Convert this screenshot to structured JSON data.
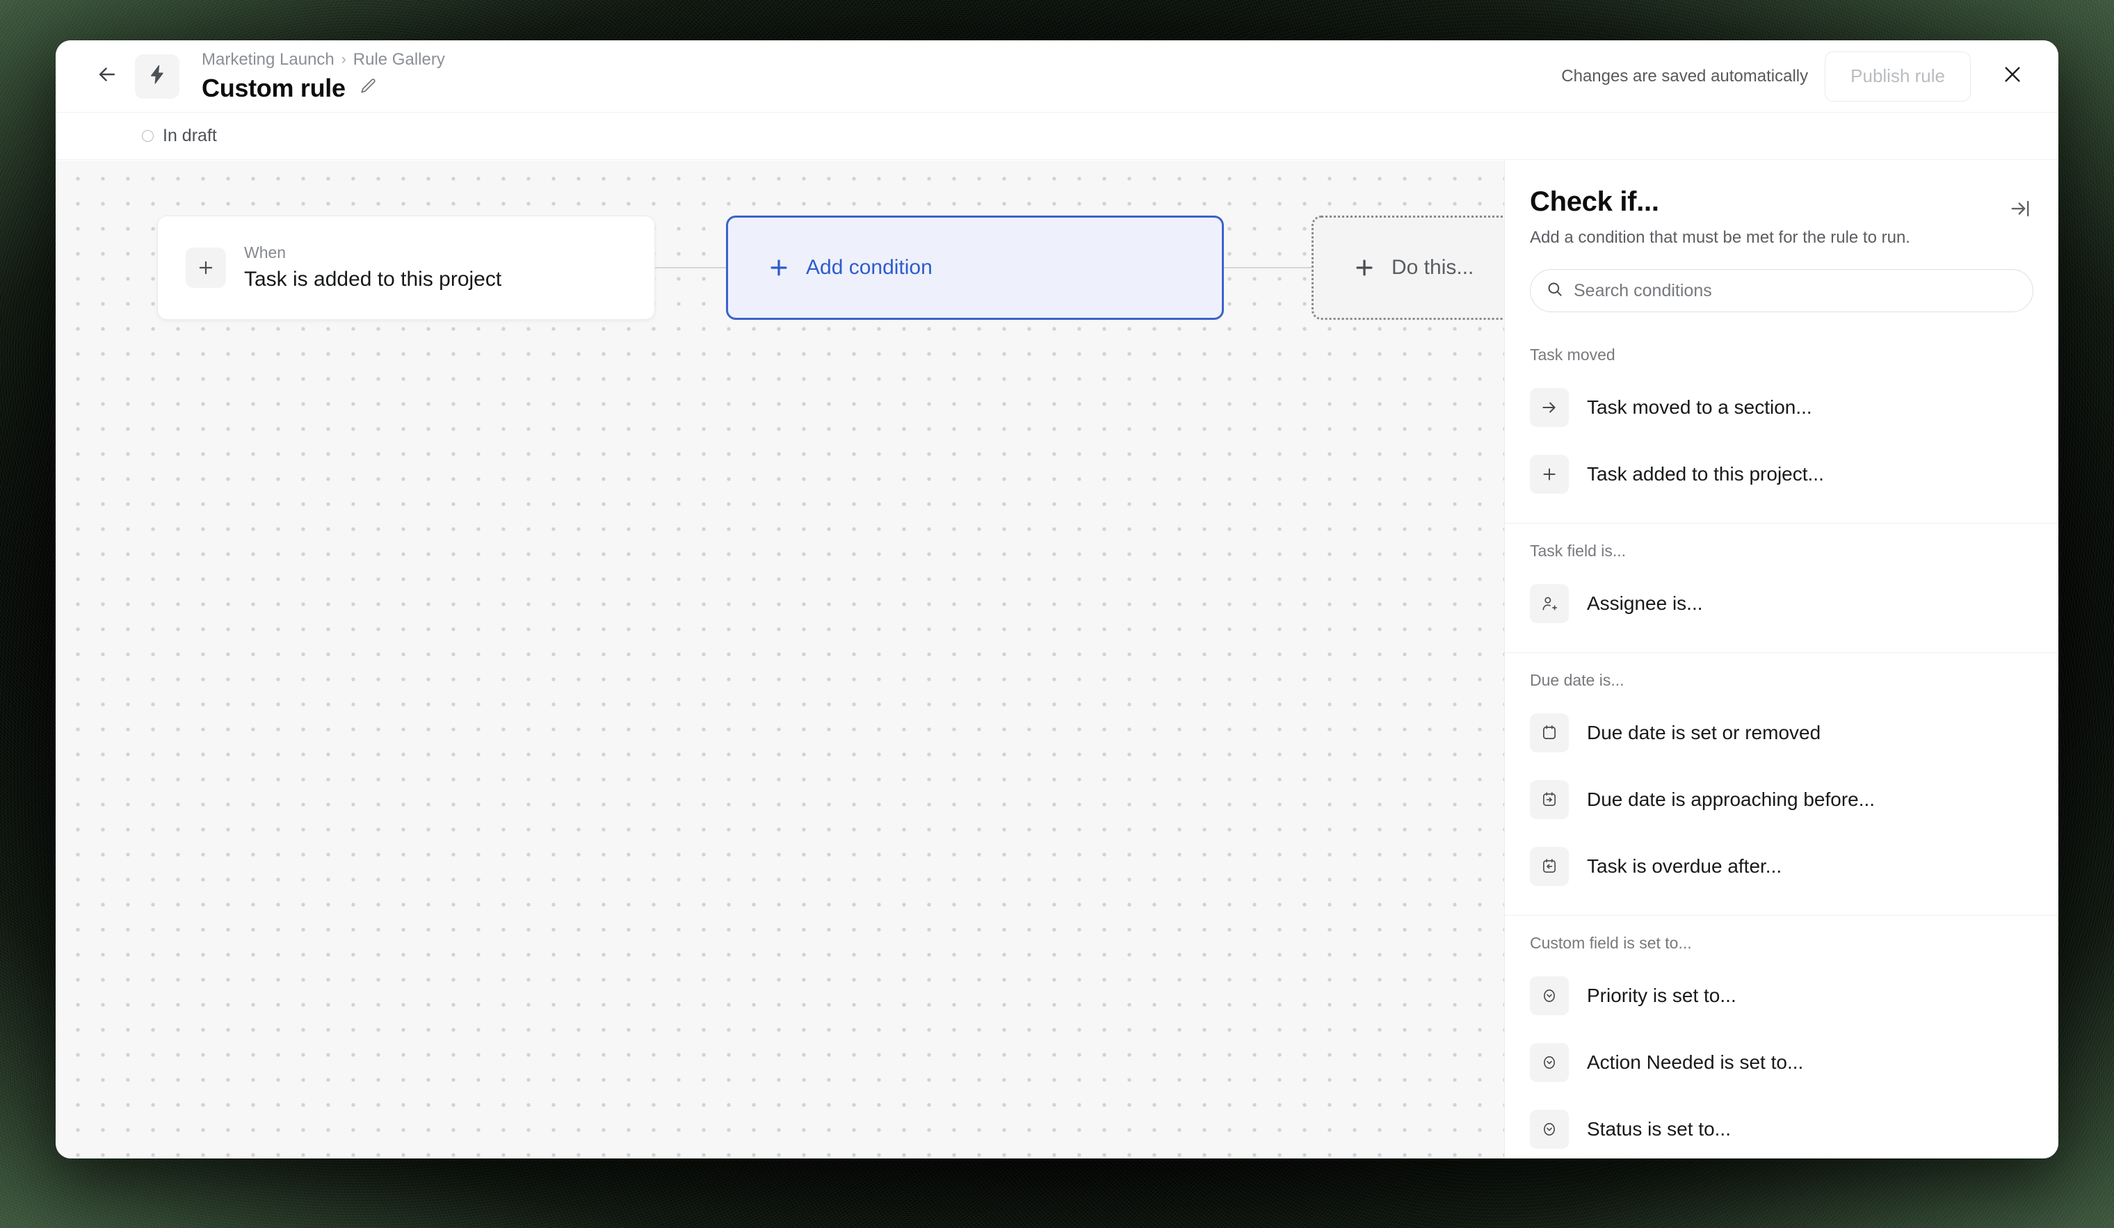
{
  "header": {
    "back_icon": "arrow-left-icon",
    "app_icon": "bolt-icon",
    "breadcrumb": {
      "project": "Marketing Launch",
      "separator": "›",
      "section": "Rule Gallery"
    },
    "rule_title": "Custom rule",
    "edit_icon": "pencil-icon",
    "saved_note": "Changes are saved automatically",
    "publish_label": "Publish rule",
    "close_icon": "close-icon"
  },
  "status": {
    "label": "In draft",
    "indicator_icon": "circle-outline-icon"
  },
  "canvas": {
    "trigger": {
      "icon": "plus-icon",
      "label": "When",
      "value": "Task is added to this project"
    },
    "condition": {
      "icon": "plus-icon",
      "label": "Add condition",
      "accent": "#2f5ccc",
      "fill": "#eef0fc",
      "border": "#3b63c9"
    },
    "action": {
      "icon": "plus-icon",
      "label": "Do this..."
    }
  },
  "panel": {
    "title": "Check if...",
    "subtitle": "Add a condition that must be met for the rule to run.",
    "collapse_icon": "collapse-right-icon",
    "search": {
      "icon": "search-icon",
      "placeholder": "Search conditions",
      "value": ""
    },
    "groups": [
      {
        "label": "Task moved",
        "items": [
          {
            "icon": "arrow-right-icon",
            "label": "Task moved to a section..."
          },
          {
            "icon": "plus-icon",
            "label": "Task added to this project..."
          }
        ]
      },
      {
        "label": "Task field is...",
        "items": [
          {
            "icon": "person-add-icon",
            "label": "Assignee is..."
          }
        ]
      },
      {
        "label": "Due date is...",
        "items": [
          {
            "icon": "calendar-icon",
            "label": "Due date is set or removed"
          },
          {
            "icon": "calendar-arrow-right-icon",
            "label": "Due date is approaching before..."
          },
          {
            "icon": "calendar-arrow-left-icon",
            "label": "Task is overdue after..."
          }
        ]
      },
      {
        "label": "Custom field is set to...",
        "items": [
          {
            "icon": "chevron-down-circle-icon",
            "label": "Priority is set to..."
          },
          {
            "icon": "chevron-down-circle-icon",
            "label": "Action Needed is set to..."
          },
          {
            "icon": "chevron-down-circle-icon",
            "label": "Status is set to..."
          }
        ]
      }
    ]
  }
}
